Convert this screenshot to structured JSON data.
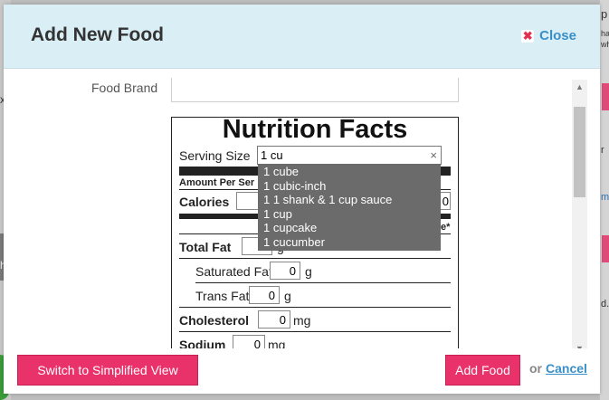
{
  "modal": {
    "title": "Add New Food",
    "close_label": "Close"
  },
  "form": {
    "food_brand_label": "Food Brand",
    "food_brand_value": ""
  },
  "nutrition": {
    "title": "Nutrition Facts",
    "serving_size_label": "Serving Size",
    "serving_size_value": "1 cu",
    "clear_symbol": "×",
    "amount_per_serving_label": "Amount Per Ser",
    "calories_label": "Calories",
    "calories_value": "",
    "calories_right_value": "0",
    "daily_value_fragment": "e*",
    "total_fat_label": "Total Fat",
    "total_fat_value": "",
    "total_fat_unit": "g",
    "saturated_fat_label": "Saturated Fat",
    "saturated_fat_value": "0",
    "saturated_fat_unit": "g",
    "trans_fat_label": "Trans Fat",
    "trans_fat_value": "0",
    "trans_fat_unit": "g",
    "cholesterol_label": "Cholesterol",
    "cholesterol_value": "0",
    "cholesterol_unit": "mg",
    "sodium_label": "Sodium",
    "sodium_value": "0",
    "sodium_unit": "mg"
  },
  "serving_suggestions": [
    "1 cube",
    "1 cubic-inch",
    "1 1 shank & 1 cup sauce",
    "1 cup",
    "1 cupcake",
    "1 cucumber"
  ],
  "footer": {
    "switch_view_label": "Switch to Simplified View",
    "add_food_label": "Add Food",
    "or_text": "or",
    "cancel_label": "Cancel"
  },
  "background": {
    "right_fragments": [
      "p",
      "ha",
      "wh",
      "my",
      "r",
      "d."
    ],
    "left_fragments": [
      "x",
      "h"
    ]
  },
  "colors": {
    "header_bg": "#daeef5",
    "accent_pink": "#e9316a",
    "link_blue": "#3a8fc6",
    "dropdown_bg": "#6b6b6b"
  }
}
